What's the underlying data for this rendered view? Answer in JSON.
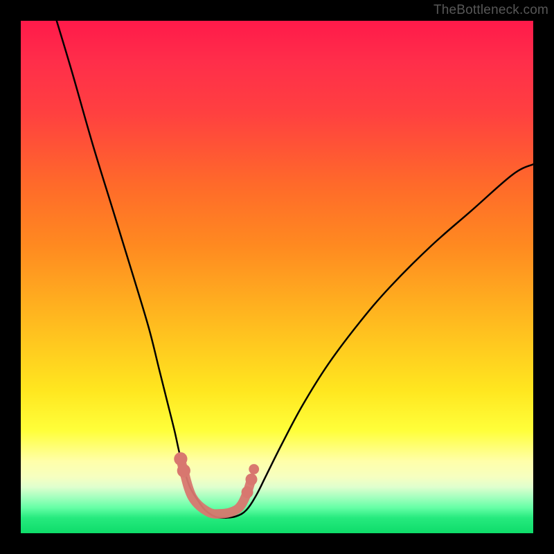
{
  "watermark": "TheBottleneck.com",
  "chart_data": {
    "type": "line",
    "title": "",
    "xlabel": "",
    "ylabel": "",
    "xlim": [
      0,
      100
    ],
    "ylim": [
      0,
      100
    ],
    "grid": false,
    "series": [
      {
        "name": "left-curve",
        "x": [
          7,
          10,
          14,
          18,
          22,
          25,
          27,
          28.5,
          30,
          31,
          32,
          33,
          34.5,
          36,
          38,
          40
        ],
        "y": [
          100,
          90,
          76,
          63,
          50,
          40,
          32,
          26,
          20,
          15.5,
          12,
          9,
          6.5,
          4.5,
          3.2,
          3
        ],
        "color": "#000000"
      },
      {
        "name": "right-curve",
        "x": [
          40,
          42,
          44,
          46,
          48,
          51,
          55,
          60,
          66,
          72,
          80,
          88,
          96,
          100
        ],
        "y": [
          3,
          3.3,
          4.5,
          7.5,
          11.5,
          17.5,
          25,
          33,
          41,
          48,
          56,
          63,
          70,
          72
        ],
        "color": "#000000"
      },
      {
        "name": "valley-marker",
        "x": [
          31.2,
          31.8,
          33.5,
          36.5,
          39,
          41.5,
          43,
          44.2,
          45
        ],
        "y": [
          14.5,
          12.2,
          7,
          4.2,
          3.8,
          4.3,
          5.5,
          8,
          10.5
        ],
        "color": "#d8776f"
      }
    ],
    "markers": [
      {
        "series": "valley-marker",
        "x": 31.2,
        "y": 14.5,
        "r": 1.3
      },
      {
        "series": "valley-marker",
        "x": 31.8,
        "y": 12.2,
        "r": 1.3
      },
      {
        "series": "valley-marker",
        "x": 44.2,
        "y": 8.0,
        "r": 1.15
      },
      {
        "series": "valley-marker",
        "x": 45.0,
        "y": 10.5,
        "r": 1.15
      },
      {
        "series": "valley-marker",
        "x": 45.5,
        "y": 12.5,
        "r": 1.0
      }
    ]
  }
}
